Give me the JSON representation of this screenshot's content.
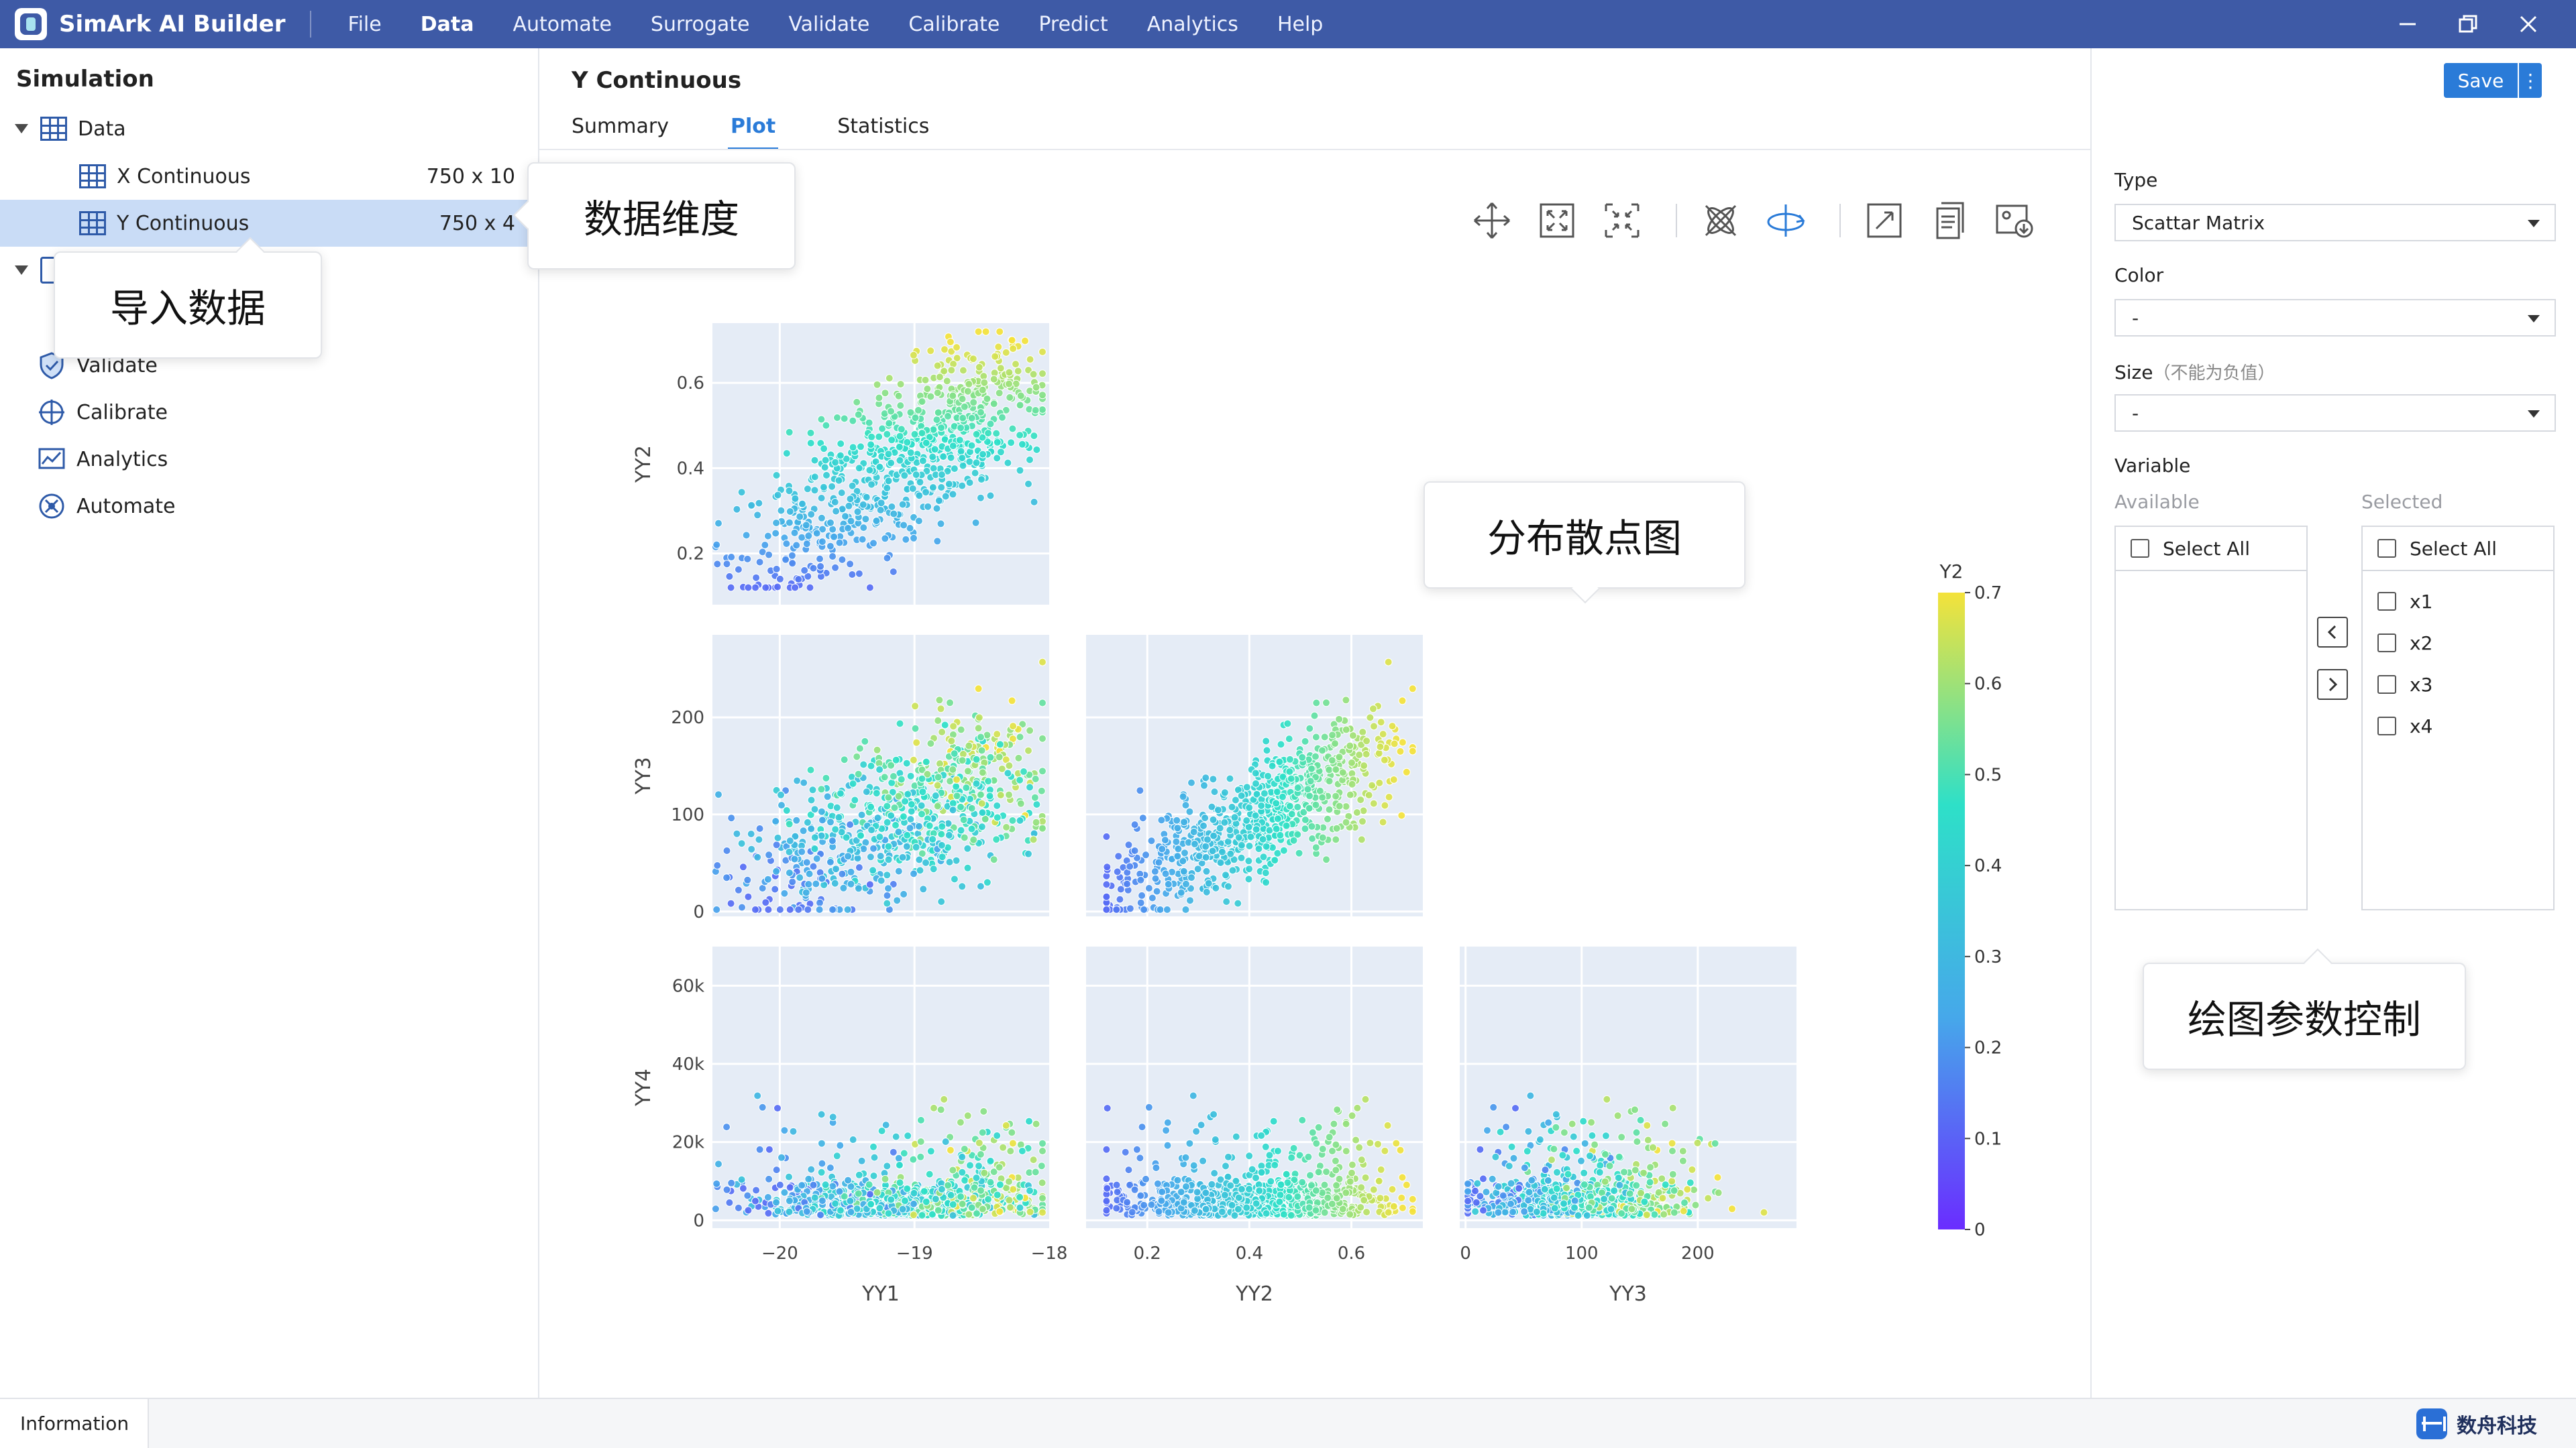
{
  "app": {
    "title": "SimArk AI Builder",
    "menu": [
      "File",
      "Data",
      "Automate",
      "Surrogate",
      "Validate",
      "Calibrate",
      "Predict",
      "Analytics",
      "Help"
    ],
    "active_menu": "Data",
    "window_controls": [
      "minimize-icon",
      "restore-icon",
      "close-icon"
    ]
  },
  "sidebar": {
    "title": "Simulation",
    "data_node": {
      "label": "Data"
    },
    "datasets": [
      {
        "label": "X Continuous",
        "dims": "750 x 10"
      },
      {
        "label": "Y Continuous",
        "dims": "750 x 4"
      }
    ],
    "other_nodes": [
      "Validate",
      "Calibrate",
      "Analytics",
      "Automate"
    ]
  },
  "callouts": {
    "dims": "数据维度",
    "import": "导入数据",
    "scatter": "分布散点图",
    "controls": "绘图参数控制"
  },
  "main": {
    "title": "Y Continuous",
    "tabs": [
      "Summary",
      "Plot",
      "Statistics"
    ],
    "active_tab": "Plot",
    "toolbar_icons": [
      "pan-icon",
      "zoom-in-icon",
      "zoom-out-icon",
      "select-icon",
      "rotate-icon",
      "autoscale-icon",
      "export-icon",
      "download-icon"
    ]
  },
  "chart_data": {
    "type": "scatter",
    "subtype": "scatter-matrix-lower-triangle",
    "color_variable": "Y2",
    "colorscale": [
      "#6a2dff",
      "#46a8ea",
      "#2ee0c8",
      "#f4e23a"
    ],
    "colorbar": {
      "title": "Y2",
      "range": [
        0,
        0.7
      ],
      "ticks": [
        "0",
        "0.1",
        "0.2",
        "0.3",
        "0.4",
        "0.5",
        "0.6",
        "0.7"
      ]
    },
    "grid": true,
    "n_points": 750,
    "axes": {
      "YY1": {
        "range": [
          -20.5,
          -18.0
        ],
        "ticks": [
          "−20",
          "−19",
          "−18"
        ],
        "tick_values": [
          -20,
          -19,
          -18
        ]
      },
      "YY2": {
        "range": [
          0.08,
          0.74
        ],
        "ticks": [
          "0.2",
          "0.4",
          "0.6"
        ],
        "tick_values": [
          0.2,
          0.4,
          0.6
        ]
      },
      "YY3": {
        "range": [
          -5,
          285
        ],
        "ticks": [
          "0",
          "100",
          "200"
        ],
        "tick_values": [
          0,
          100,
          200
        ]
      },
      "YY4": {
        "range": [
          -2000,
          70000
        ],
        "ticks": [
          "0",
          "20k",
          "40k",
          "60k"
        ],
        "tick_values": [
          0,
          20000,
          40000,
          60000
        ]
      }
    },
    "panels": [
      {
        "row": 0,
        "col": 0,
        "x": "YY1",
        "y": "YY2"
      },
      {
        "row": 1,
        "col": 0,
        "x": "YY1",
        "y": "YY3"
      },
      {
        "row": 1,
        "col": 1,
        "x": "YY2",
        "y": "YY3"
      },
      {
        "row": 2,
        "col": 0,
        "x": "YY1",
        "y": "YY4"
      },
      {
        "row": 2,
        "col": 1,
        "x": "YY2",
        "y": "YY4"
      },
      {
        "row": 2,
        "col": 2,
        "x": "YY3",
        "y": "YY4"
      }
    ],
    "row_labels": [
      "YY2",
      "YY3",
      "YY4"
    ],
    "col_labels": [
      "YY1",
      "YY2",
      "YY3"
    ]
  },
  "right_panel": {
    "save_label": "Save",
    "save_more": "⋮",
    "type_label": "Type",
    "type_value": "Scattar Matrix",
    "color_label": "Color",
    "color_value": "-",
    "size_label": "Size",
    "size_hint": "（不能为负值）",
    "size_value": "-",
    "variable_label": "Variable",
    "available_label": "Available",
    "selected_label": "Selected",
    "select_all": "Select All",
    "selected_items": [
      "x1",
      "x2",
      "x3",
      "x4"
    ]
  },
  "statusbar": {
    "info_tab": "Information",
    "brand": "数舟科技"
  }
}
